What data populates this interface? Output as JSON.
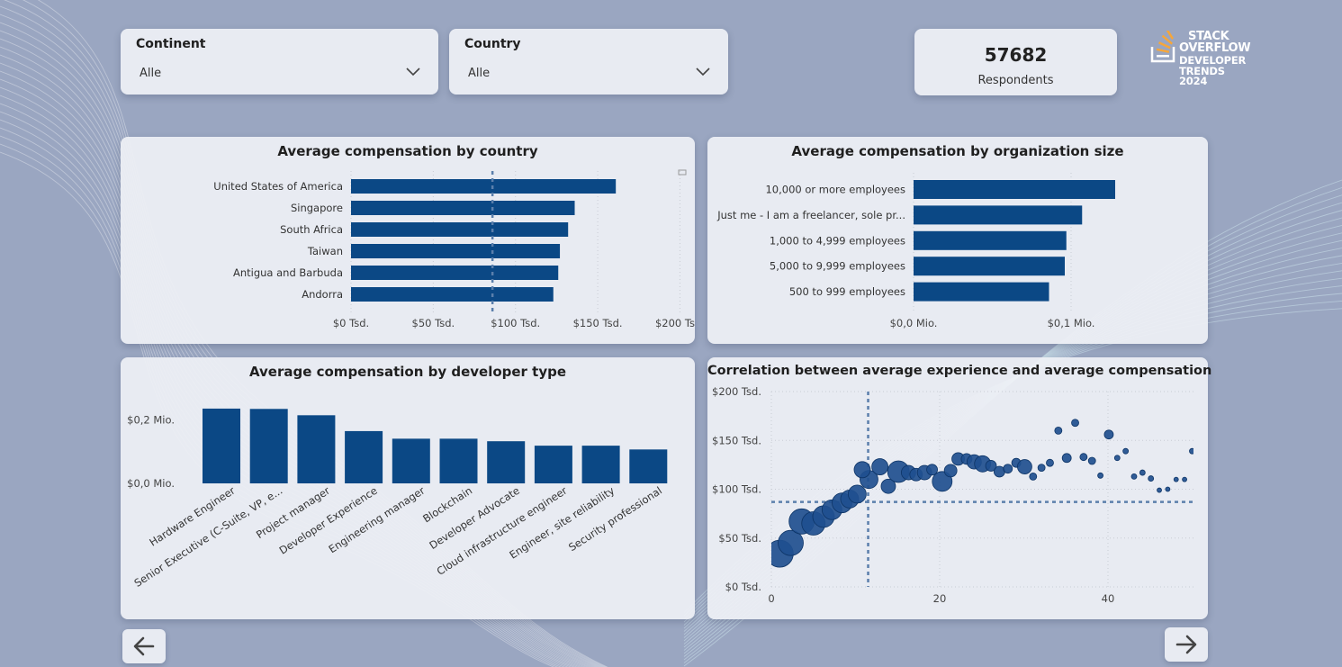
{
  "filters": {
    "continent": {
      "label": "Continent",
      "value": "Alle"
    },
    "country": {
      "label": "Country",
      "value": "Alle"
    }
  },
  "kpi": {
    "value": "57682",
    "label": "Respondents"
  },
  "logo": {
    "line1": "STACK",
    "line2": "OVERFLOW",
    "line3": "DEVELOPER",
    "line4": "TRENDS",
    "line5": "2024"
  },
  "colors": {
    "bar": "#0b4885",
    "reference_line": "#5b7fac",
    "background": "#9aa6c1"
  },
  "icons": {
    "dropdown": "chevron-down-icon",
    "back": "arrow-left-icon",
    "next": "arrow-right-icon",
    "logo": "stack-overflow-icon"
  },
  "chart_data": [
    {
      "type": "bar",
      "orientation": "horizontal",
      "title": "Average compensation by country",
      "categories": [
        "United States of America",
        "Singapore",
        "South Africa",
        "Taiwan",
        "Antigua and Barbuda",
        "Andorra"
      ],
      "values": [
        161000,
        136000,
        132000,
        127000,
        126000,
        123000
      ],
      "xlim": [
        0,
        220000
      ],
      "ticks": [
        0,
        50000,
        100000,
        150000,
        200000
      ],
      "tick_labels": [
        "$0 Tsd.",
        "$50 Tsd.",
        "$100 Tsd.",
        "$150 Tsd.",
        "$200 Tsd."
      ],
      "reference_line": 86000
    },
    {
      "type": "bar",
      "orientation": "horizontal",
      "title": "Average compensation by organization size",
      "categories": [
        "10,000 or more employees",
        "Just me - I am a freelancer, sole pr...",
        "1,000 to 4,999 employees",
        "5,000 to 9,999 employees",
        "500 to 999 employees"
      ],
      "values": [
        128000,
        107000,
        97000,
        96000,
        86000
      ],
      "xlim": [
        0,
        170000
      ],
      "ticks": [
        0,
        100000
      ],
      "tick_labels": [
        "$0,0 Mio.",
        "$0,1 Mio."
      ]
    },
    {
      "type": "bar",
      "orientation": "vertical",
      "title": "Average compensation by developer type",
      "categories": [
        "Hardware Engineer",
        "Senior Executive (C-Suite, VP, e...",
        "Project manager",
        "Developer Experience",
        "Engineering manager",
        "Blockchain",
        "Developer Advocate",
        "Cloud infrastructure engineer",
        "Engineer, site reliability",
        "Security professional"
      ],
      "values": [
        236000,
        235000,
        215000,
        165000,
        141000,
        141000,
        133000,
        119000,
        119000,
        107000
      ],
      "ylim": [
        0,
        250000
      ],
      "ticks": [
        0,
        200000
      ],
      "tick_labels": [
        "$0,0 Mio.",
        "$0,2 Mio."
      ]
    },
    {
      "type": "scatter",
      "title": "Correlation between average experience and average compensation",
      "xlim": [
        0,
        50
      ],
      "ylim": [
        0,
        200000
      ],
      "x_ticks": [
        0,
        20,
        40
      ],
      "y_ticks": [
        0,
        50000,
        100000,
        150000,
        200000
      ],
      "y_tick_labels": [
        "$0 Tsd.",
        "$50 Tsd.",
        "$100 Tsd.",
        "$150 Tsd.",
        "$200 Tsd."
      ],
      "reference_x": 11.5,
      "reference_y": 87000,
      "points": [
        {
          "x": 1,
          "y": 34000,
          "s": 15
        },
        {
          "x": 2.3,
          "y": 45000,
          "s": 14
        },
        {
          "x": 3.6,
          "y": 67000,
          "s": 14
        },
        {
          "x": 5,
          "y": 65000,
          "s": 13
        },
        {
          "x": 6.2,
          "y": 72000,
          "s": 12
        },
        {
          "x": 7.2,
          "y": 79000,
          "s": 11
        },
        {
          "x": 8.4,
          "y": 86000,
          "s": 11
        },
        {
          "x": 9.3,
          "y": 90000,
          "s": 10
        },
        {
          "x": 10.2,
          "y": 95000,
          "s": 10
        },
        {
          "x": 11.6,
          "y": 110000,
          "s": 10
        },
        {
          "x": 10.8,
          "y": 120000,
          "s": 9
        },
        {
          "x": 12.9,
          "y": 123000,
          "s": 9
        },
        {
          "x": 13.9,
          "y": 103000,
          "s": 8
        },
        {
          "x": 15.1,
          "y": 118000,
          "s": 12
        },
        {
          "x": 16.3,
          "y": 117000,
          "s": 8
        },
        {
          "x": 17.2,
          "y": 115000,
          "s": 7
        },
        {
          "x": 18.2,
          "y": 117000,
          "s": 8
        },
        {
          "x": 19.1,
          "y": 120000,
          "s": 6
        },
        {
          "x": 20.3,
          "y": 108000,
          "s": 11
        },
        {
          "x": 21.3,
          "y": 119000,
          "s": 7
        },
        {
          "x": 22.2,
          "y": 131000,
          "s": 7
        },
        {
          "x": 23.2,
          "y": 131000,
          "s": 6
        },
        {
          "x": 24.1,
          "y": 128000,
          "s": 8
        },
        {
          "x": 25.1,
          "y": 126000,
          "s": 9
        },
        {
          "x": 26.1,
          "y": 124000,
          "s": 6
        },
        {
          "x": 27.1,
          "y": 118000,
          "s": 6
        },
        {
          "x": 28.1,
          "y": 121000,
          "s": 5
        },
        {
          "x": 29.1,
          "y": 127000,
          "s": 5
        },
        {
          "x": 30.1,
          "y": 123000,
          "s": 8
        },
        {
          "x": 31.1,
          "y": 113000,
          "s": 4
        },
        {
          "x": 32.1,
          "y": 122000,
          "s": 4
        },
        {
          "x": 33.1,
          "y": 127000,
          "s": 4
        },
        {
          "x": 34.1,
          "y": 160000,
          "s": 4
        },
        {
          "x": 35.1,
          "y": 132000,
          "s": 5
        },
        {
          "x": 36.1,
          "y": 168000,
          "s": 4
        },
        {
          "x": 37.1,
          "y": 133000,
          "s": 4
        },
        {
          "x": 38.1,
          "y": 129000,
          "s": 4
        },
        {
          "x": 39.1,
          "y": 114000,
          "s": 3
        },
        {
          "x": 40.1,
          "y": 156000,
          "s": 5
        },
        {
          "x": 41.1,
          "y": 132000,
          "s": 3
        },
        {
          "x": 42.1,
          "y": 139000,
          "s": 3
        },
        {
          "x": 43.1,
          "y": 113000,
          "s": 3
        },
        {
          "x": 44.1,
          "y": 117000,
          "s": 3
        },
        {
          "x": 45.1,
          "y": 111000,
          "s": 3
        },
        {
          "x": 46.1,
          "y": 99000,
          "s": 2.5
        },
        {
          "x": 47.1,
          "y": 100000,
          "s": 2.5
        },
        {
          "x": 48.1,
          "y": 110000,
          "s": 2.5
        },
        {
          "x": 49.1,
          "y": 110000,
          "s": 2.5
        },
        {
          "x": 50,
          "y": 139000,
          "s": 3
        }
      ]
    }
  ]
}
